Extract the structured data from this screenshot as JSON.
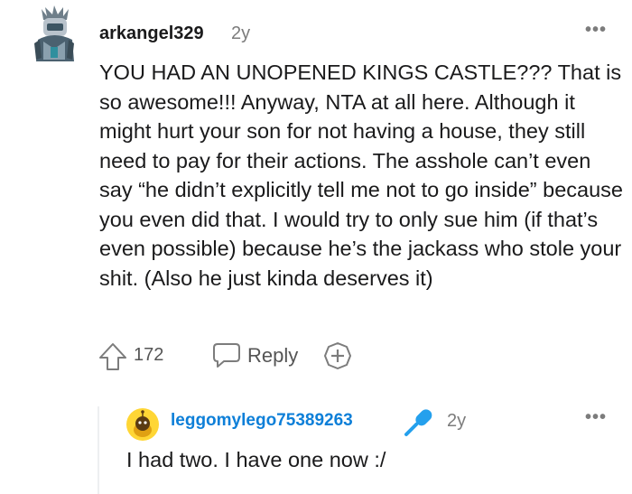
{
  "comment": {
    "username": "arkangel329",
    "age": "2y",
    "more_menu": "•••",
    "body": "YOU HAD AN UNOPENED KINGS CASTLE??? That is so awesome!!! Anyway, NTA at all here. Although it might hurt your son for not having a house, they still need to pay for their actions. The asshole can’t even say “he didn’t explicitly tell me not to go inside” because you even did that. I would try to only sue him (if that’s even possible) because he’s the jackass who stole your shit. (Also he just kinda deserves it)",
    "votes": "172",
    "reply_label": "Reply",
    "icons": {
      "upvote": "arrow-up-icon",
      "reply": "speech-bubble-icon",
      "award": "plus-circle-icon"
    }
  },
  "reply": {
    "username": "leggomylego75389263",
    "age": "2y",
    "more_menu": "•••",
    "body": "I had two. I have one now :/",
    "flair_icon": "microphone-icon"
  },
  "colors": {
    "username_link": "#0d7fd8",
    "meta": "#7c7c7c",
    "avatar_yellow": "#ffd635",
    "mic_blue": "#24a0ed"
  }
}
